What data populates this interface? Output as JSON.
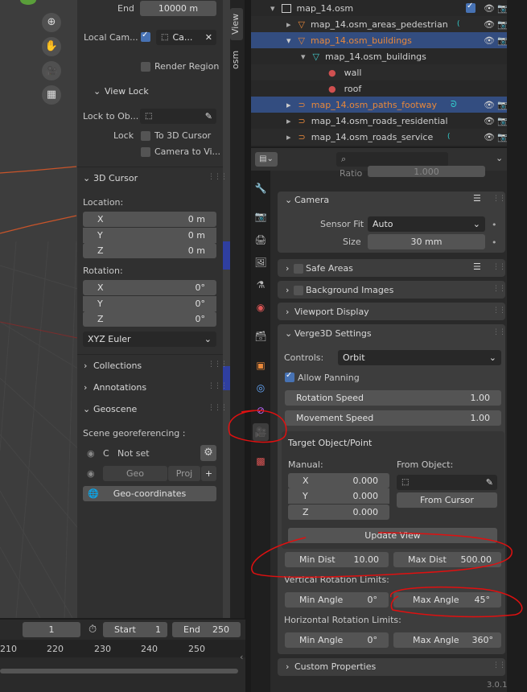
{
  "npanel": {
    "end_label": "End",
    "end_value": "10000 m",
    "local_camera_label": "Local Cam...",
    "local_camera_value": "Ca...",
    "render_region_label": "Render Region",
    "view_lock_header": "View Lock",
    "lock_to_object_label": "Lock to Ob...",
    "lock_label": "Lock",
    "to_3d_cursor_label": "To 3D Cursor",
    "camera_to_view_label": "Camera to Vi...",
    "cursor_header": "3D Cursor",
    "location_label": "Location:",
    "location": [
      {
        "axis": "X",
        "value": "0 m"
      },
      {
        "axis": "Y",
        "value": "0 m"
      },
      {
        "axis": "Z",
        "value": "0 m"
      }
    ],
    "rotation_label": "Rotation:",
    "rotation": [
      {
        "axis": "X",
        "value": "0°"
      },
      {
        "axis": "Y",
        "value": "0°"
      },
      {
        "axis": "Z",
        "value": "0°"
      }
    ],
    "rotation_mode": "XYZ Euler",
    "collections_header": "Collections",
    "annotations_header": "Annotations",
    "geoscene_header": "Geoscene",
    "georef_label": "Scene georeferencing :",
    "c_label": "C",
    "not_set_label": "Not set",
    "geo_button": "Geo",
    "proj_button": "Proj",
    "plus_button": "+",
    "geo_coordinates_button": "Geo-coordinates"
  },
  "side_tabs": [
    "View",
    "osm"
  ],
  "outliner": {
    "rows": [
      {
        "label": "map_14.osm",
        "color": "#d0d0d0"
      },
      {
        "label": "map_14.osm_areas_pedestrian",
        "color": "#d0d0d0"
      },
      {
        "label": "map_14.osm_buildings",
        "color": "#e8883a"
      },
      {
        "label": "map_14.osm_buildings",
        "color": "#d0d0d0"
      },
      {
        "label": "wall",
        "color": "#d0d0d0"
      },
      {
        "label": "roof",
        "color": "#d0d0d0"
      },
      {
        "label": "map_14.osm_paths_footway",
        "color": "#e8883a"
      },
      {
        "label": "map_14.osm_roads_residential",
        "color": "#d0d0d0"
      },
      {
        "label": "map_14.osm_roads_service",
        "color": "#d0d0d0"
      }
    ]
  },
  "properties": {
    "ratio_label": "Ratio",
    "ratio_value": "1.000",
    "camera_header": "Camera",
    "sensor_fit_label": "Sensor Fit",
    "sensor_fit_value": "Auto",
    "size_label": "Size",
    "size_value": "30 mm",
    "safe_areas_header": "Safe Areas",
    "background_images_header": "Background Images",
    "viewport_display_header": "Viewport Display",
    "verge3d_header": "Verge3D Settings",
    "controls_label": "Controls:",
    "controls_value": "Orbit",
    "allow_panning_label": "Allow Panning",
    "rotation_speed_label": "Rotation Speed",
    "rotation_speed_value": "1.00",
    "movement_speed_label": "Movement Speed",
    "movement_speed_value": "1.00",
    "target_header": "Target Object/Point",
    "manual_label": "Manual:",
    "from_object_label": "From Object:",
    "manual": [
      {
        "axis": "X",
        "value": "0.000"
      },
      {
        "axis": "Y",
        "value": "0.000"
      },
      {
        "axis": "Z",
        "value": "0.000"
      }
    ],
    "from_cursor_button": "From Cursor",
    "update_view_button": "Update View",
    "min_dist_label": "Min Dist",
    "min_dist_value": "10.00",
    "max_dist_label": "Max Dist",
    "max_dist_value": "500.00",
    "vertical_limits_label": "Vertical Rotation Limits:",
    "v_min_angle_label": "Min Angle",
    "v_min_angle_value": "0°",
    "v_max_angle_label": "Max Angle",
    "v_max_angle_value": "45°",
    "horizontal_limits_label": "Horizontal Rotation Limits:",
    "h_min_angle_label": "Min Angle",
    "h_min_angle_value": "0°",
    "h_max_angle_label": "Max Angle",
    "h_max_angle_value": "360°",
    "custom_properties_header": "Custom Properties"
  },
  "timeline": {
    "current_frame": "1",
    "start_label": "Start",
    "start_value": "1",
    "end_label": "End",
    "end_value": "250",
    "ruler": [
      "210",
      "220",
      "230",
      "240",
      "250"
    ]
  },
  "version": "3.0.1",
  "colors": {
    "accent": "#4772b3",
    "selected_row": "#334d80",
    "annotation_red": "#e01010",
    "active_object": "#e8883a"
  }
}
